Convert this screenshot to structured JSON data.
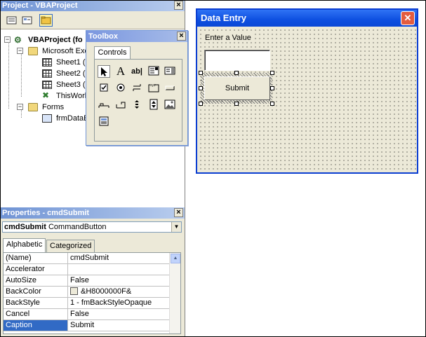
{
  "project": {
    "title": "Project - VBAProject",
    "tree": {
      "root": "VBAProject (fo",
      "excel_objects": "Microsoft Exc",
      "sheets": [
        "Sheet1 (",
        "Sheet2 (S",
        "Sheet3 (S"
      ],
      "workbook": "ThisWork",
      "forms": "Forms",
      "form_item": "frmDataE"
    }
  },
  "toolbox": {
    "title": "Toolbox",
    "tab": "Controls",
    "tools": [
      "pointer-icon",
      "label-tool-icon",
      "textbox-tool-icon",
      "combobox-tool-icon",
      "listbox-tool-icon",
      "checkbox-tool-icon",
      "optionbutton-tool-icon",
      "togglebutton-tool-icon",
      "frame-tool-icon",
      "commandbutton-tool-icon",
      "tabstrip-tool-icon",
      "multipage-tool-icon",
      "scrollbar-tool-icon",
      "spinbutton-tool-icon",
      "image-tool-icon",
      "refedit-tool-icon"
    ],
    "label_glyph": "A",
    "textbox_glyph": "ab|"
  },
  "properties": {
    "title": "Properties - cmdSubmit",
    "object_name": "cmdSubmit",
    "object_type": "CommandButton",
    "tabs": [
      "Alphabetic",
      "Categorized"
    ],
    "rows": [
      {
        "name": "(Name)",
        "value": "cmdSubmit"
      },
      {
        "name": "Accelerator",
        "value": ""
      },
      {
        "name": "AutoSize",
        "value": "False"
      },
      {
        "name": "BackColor",
        "value": "&H8000000F&"
      },
      {
        "name": "BackStyle",
        "value": "1 - fmBackStyleOpaque"
      },
      {
        "name": "Cancel",
        "value": "False"
      },
      {
        "name": "Caption",
        "value": "Submit"
      }
    ]
  },
  "form": {
    "title": "Data Entry",
    "label": "Enter a Value",
    "button": "Submit",
    "close_glyph": "✕"
  },
  "colors": {
    "titlebar_blue": "#0e4fe0",
    "selection": "#316ac5",
    "close_red": "#e35c3f",
    "face": "#ece9d8"
  }
}
